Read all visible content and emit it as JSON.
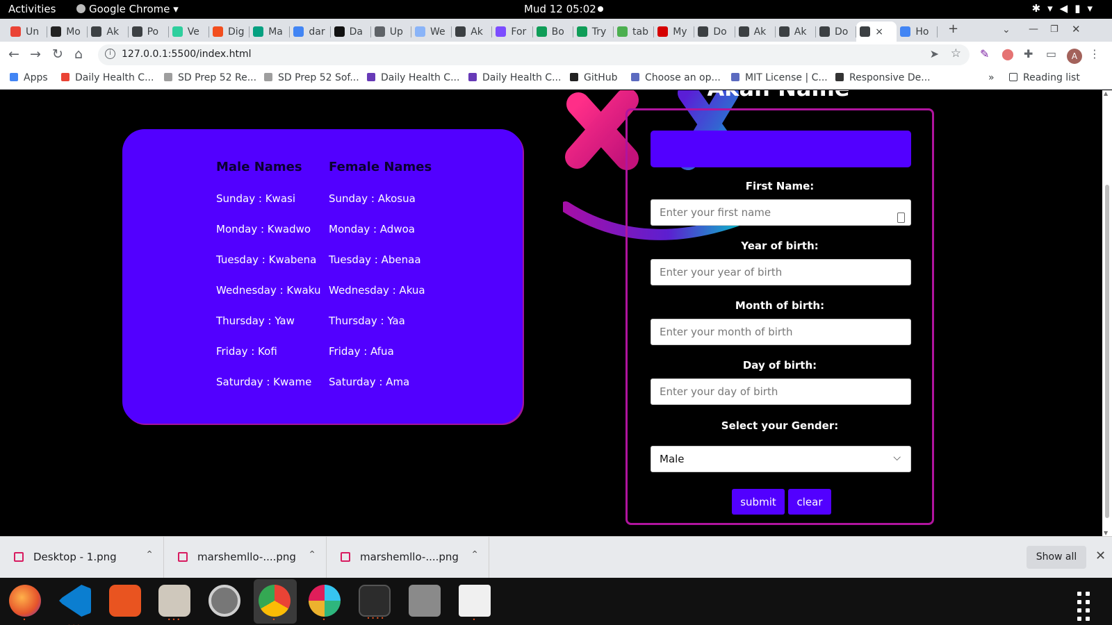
{
  "system_bar": {
    "activities": "Activities",
    "app_name": "Google Chrome ▾",
    "clock": "Mud 12  05:02"
  },
  "browser": {
    "tabs": [
      {
        "label": "Un",
        "color": "#ea4335"
      },
      {
        "label": "Mo",
        "color": "#222222"
      },
      {
        "label": "Ak",
        "color": "#3c4043"
      },
      {
        "label": "Po",
        "color": "#3c4043"
      },
      {
        "label": "Ve",
        "color": "#2ecf9e"
      },
      {
        "label": "Dig",
        "color": "#f24e1e"
      },
      {
        "label": "Ma",
        "color": "#05a081"
      },
      {
        "label": "dar",
        "color": "#4285f4"
      },
      {
        "label": "Da",
        "color": "#111111"
      },
      {
        "label": "Up",
        "color": "#5f6368"
      },
      {
        "label": "We",
        "color": "#8ab4f8"
      },
      {
        "label": "Ak",
        "color": "#3c4043"
      },
      {
        "label": "For",
        "color": "#7c4dff"
      },
      {
        "label": "Bo",
        "color": "#0f9d58"
      },
      {
        "label": "Try",
        "color": "#0f9d58"
      },
      {
        "label": "tab",
        "color": "#4caf50"
      },
      {
        "label": "My",
        "color": "#d50000"
      },
      {
        "label": "Do",
        "color": "#3c4043"
      },
      {
        "label": "Ak",
        "color": "#3c4043"
      },
      {
        "label": "Ak",
        "color": "#3c4043"
      },
      {
        "label": "Do",
        "color": "#3c4043"
      },
      {
        "label": "×",
        "color": "#3c4043",
        "active": true
      },
      {
        "label": "Ho",
        "color": "#4285f4"
      }
    ],
    "new_tab": "+",
    "url": "127.0.0.1:5500/index.html",
    "profile_initial": "A",
    "bookmarks": [
      {
        "label": "Apps",
        "color": "#4285f4"
      },
      {
        "label": "Daily Health C...",
        "color": "#ea4335"
      },
      {
        "label": "SD Prep 52 Re...",
        "color": "#9e9e9e"
      },
      {
        "label": "SD Prep 52 Sof...",
        "color": "#9e9e9e"
      },
      {
        "label": "Daily Health C...",
        "color": "#673ab7"
      },
      {
        "label": "Daily Health C...",
        "color": "#673ab7"
      },
      {
        "label": "GitHub",
        "color": "#222222"
      },
      {
        "label": "Choose an op...",
        "color": "#5c6bc0"
      },
      {
        "label": "MIT License | C...",
        "color": "#5c6bc0"
      },
      {
        "label": "Responsive De...",
        "color": "#333333"
      }
    ],
    "bookmarks_overflow": "»",
    "reading_list": "Reading list"
  },
  "page": {
    "heading": "Akan Name",
    "male_header": "Male Names",
    "female_header": "Female Names",
    "male_names": [
      "Sunday : Kwasi",
      "Monday : Kwadwo",
      "Tuesday : Kwabena",
      "Wednesday : Kwaku",
      "Thursday : Yaw",
      "Friday : Kofi",
      "Saturday : Kwame"
    ],
    "female_names": [
      "Sunday : Akosua",
      "Monday : Adwoa",
      "Tuesday : Abenaa",
      "Wednesday : Akua",
      "Thursday : Yaa",
      "Friday : Afua",
      "Saturday : Ama"
    ],
    "form": {
      "first_name_label": "First Name:",
      "first_name_placeholder": "Enter your first name",
      "year_label": "Year of birth:",
      "year_placeholder": "Enter your year of birth",
      "month_label": "Month of birth:",
      "month_placeholder": "Enter your month of birth",
      "day_label": "Day of birth:",
      "day_placeholder": "Enter your day of birth",
      "gender_label": "Select your Gender:",
      "gender_value": "Male",
      "submit_label": "submit",
      "clear_label": "clear"
    }
  },
  "downloads": {
    "items": [
      "Desktop - 1.png",
      "marshemllo-....png",
      "marshemllo-....png"
    ],
    "show_all": "Show all"
  },
  "dock": {
    "apps": [
      "firefox-icon",
      "vscode-icon",
      "software-center-icon",
      "files-icon",
      "settings-icon",
      "chrome-icon",
      "slack-icon",
      "terminal-icon",
      "image-viewer-icon",
      "text-editor-icon"
    ]
  },
  "colors": {
    "accent_purple": "#5200ff",
    "form_border": "#b0149e"
  }
}
